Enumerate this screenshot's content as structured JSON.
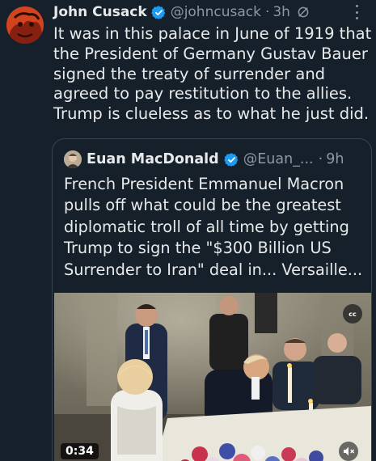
{
  "tweet": {
    "author_name": "John Cusack",
    "handle": "@johncusack",
    "separator": "·",
    "time": "3h",
    "text_lines": [
      "It was in this palace in June of 1919 that",
      "the President of Germany Gustav Bauer",
      "signed the treaty of surrender and",
      "agreed to pay restitution to the allies.",
      "Trump is clueless as to what he just did."
    ]
  },
  "quote": {
    "author_name": "Euan MacDonald",
    "handle": "@Euan_...",
    "separator": "·",
    "time": "9h",
    "text_lines": [
      "French President Emmanuel Macron",
      "pulls off what could be the greatest",
      "diplomatic troll of all time by getting",
      "Trump to sign the \"$300 Billion US",
      "Surrender to Iran\" deal in... Versaille..."
    ],
    "video": {
      "cc_label": "cc",
      "duration": "0:34"
    }
  },
  "icons": {
    "verified": "verified-badge-icon",
    "edit": "edit-icon",
    "more": "more-icon",
    "mute": "speaker-muted-icon"
  },
  "colors": {
    "background": "#15202b",
    "text": "#e7e9ea",
    "secondary_text": "#8b98a5",
    "border": "#38444d",
    "verified_blue": "#1d9bf0"
  }
}
